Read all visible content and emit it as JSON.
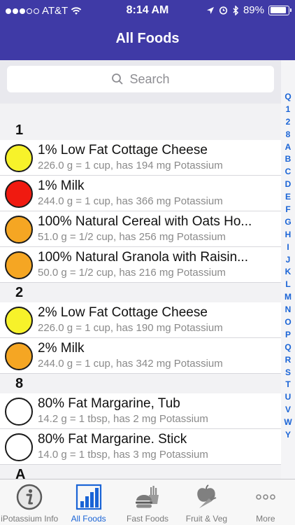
{
  "status": {
    "carrier": "AT&T",
    "time": "8:14 AM",
    "battery": "89%",
    "battery_fraction": 0.89
  },
  "nav": {
    "title": "All Foods"
  },
  "search": {
    "placeholder": "Search"
  },
  "colors": {
    "nav": "#3f3aa6",
    "accent": "#1a64d6",
    "yellow": "#f7f22a",
    "red": "#f01a10",
    "orange": "#f5a623",
    "white": "#ffffff"
  },
  "sections": [
    {
      "header": "1",
      "rows": [
        {
          "name": "1% Low Fat Cottage Cheese",
          "detail": "226.0 g = 1 cup, has 194 mg Potassium",
          "color": "#f7f22a"
        },
        {
          "name": "1% Milk",
          "detail": "244.0 g = 1 cup, has 366 mg Potassium",
          "color": "#f01a10"
        },
        {
          "name": "100% Natural Cereal with Oats Ho...",
          "detail": "51.0 g = 1/2 cup, has 256 mg Potassium",
          "color": "#f5a623"
        },
        {
          "name": "100% Natural Granola with Raisin...",
          "detail": "50.0 g = 1/2 cup, has 216 mg Potassium",
          "color": "#f5a623"
        }
      ]
    },
    {
      "header": "2",
      "rows": [
        {
          "name": "2% Low Fat Cottage Cheese",
          "detail": "226.0 g = 1 cup, has 190 mg Potassium",
          "color": "#f7f22a"
        },
        {
          "name": "2% Milk",
          "detail": "244.0 g = 1 cup, has 342 mg Potassium",
          "color": "#f5a623"
        }
      ]
    },
    {
      "header": "8",
      "rows": [
        {
          "name": "80% Fat Margarine, Tub",
          "detail": "14.2 g = 1 tbsp, has 2 mg Potassium",
          "color": "#ffffff"
        },
        {
          "name": "80% Fat Margarine. Stick",
          "detail": "14.0 g = 1 tbsp, has 3 mg Potassium",
          "color": "#ffffff"
        }
      ]
    },
    {
      "header": "A",
      "rows": []
    }
  ],
  "index": [
    "Q",
    "1",
    "2",
    "8",
    "A",
    "B",
    "C",
    "D",
    "E",
    "F",
    "G",
    "H",
    "I",
    "J",
    "K",
    "L",
    "M",
    "N",
    "O",
    "P",
    "Q",
    "R",
    "S",
    "T",
    "U",
    "V",
    "W",
    "Y"
  ],
  "tabs": [
    {
      "label": "iPotassium Info",
      "icon": "info-icon"
    },
    {
      "label": "All Foods",
      "icon": "bar-chart-icon",
      "active": true
    },
    {
      "label": "Fast Foods",
      "icon": "burger-fries-icon"
    },
    {
      "label": "Fruit & Veg",
      "icon": "apple-carrot-icon"
    },
    {
      "label": "More",
      "icon": "more-icon"
    }
  ]
}
